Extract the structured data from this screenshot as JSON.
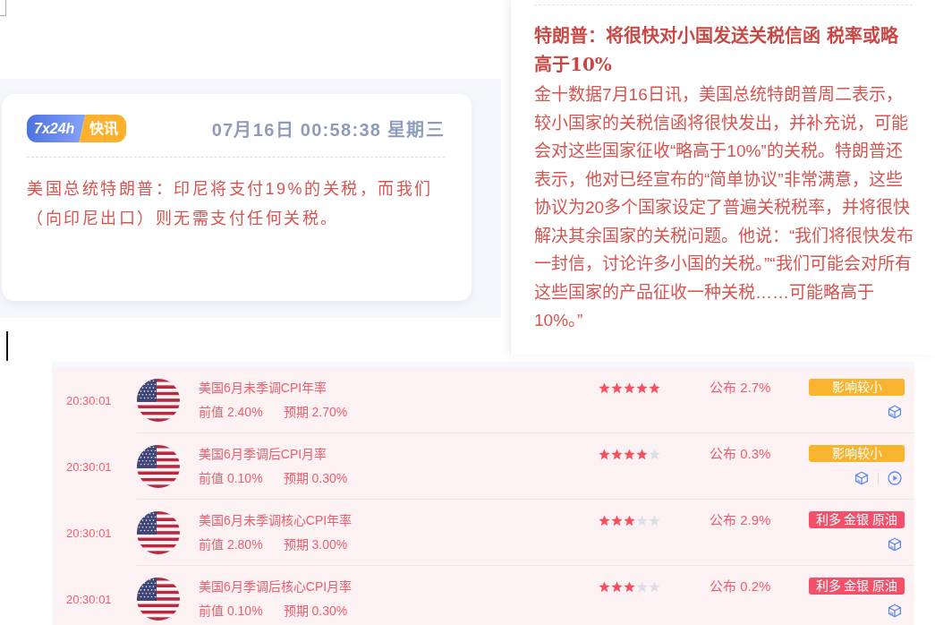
{
  "flash_card": {
    "badge": {
      "left": "7x24h",
      "right": "快讯"
    },
    "datetime": "07月16日 00:58:38 星期三",
    "text": "美国总统特朗普：印尼将支付19%的关税，而我们（向印尼出口）则无需支付任何关税。"
  },
  "article": {
    "title": "特朗普：将很快对小国发送关税信函 税率或略高于10%",
    "body": "金十数据7月16日讯，美国总统特朗普周二表示，较小国家的关税信函将很快发出，并补充说，可能会对这些国家征收“略高于10%”的关税。特朗普还表示，他对已经宣布的“简单协议”非常满意，这些协议为20多个国家设定了普遍关税税率，并将很快解决其余国家的关税问题。他说：“我们将很快发布一封信，讨论许多小国的关税。”“我们可能会对所有这些国家的产品征收一种关税……可能略高于10%。”"
  },
  "calendar": {
    "rows": [
      {
        "time": "20:30:01",
        "title": "美国6月未季调CPI年率",
        "previous": "前值 2.40%",
        "forecast": "预期 2.70%",
        "stars": 5,
        "actual": "公布 2.7%",
        "impact": {
          "label": "影响较小",
          "color": "#f8b42e"
        },
        "video": false
      },
      {
        "time": "20:30:01",
        "title": "美国6月季调后CPI月率",
        "previous": "前值 0.10%",
        "forecast": "预期 0.30%",
        "stars": 4,
        "actual": "公布 0.3%",
        "impact": {
          "label": "影响较小",
          "color": "#f8b42e"
        },
        "video": true
      },
      {
        "time": "20:30:01",
        "title": "美国6月未季调核心CPI年率",
        "previous": "前值 2.80%",
        "forecast": "预期 3.00%",
        "stars": 3,
        "actual": "公布 2.9%",
        "impact": {
          "label": "利多 金银 原油",
          "color": "#f5506a"
        },
        "video": false
      },
      {
        "time": "20:30:01",
        "title": "美国6月季调后核心CPI月率",
        "previous": "前值 0.10%",
        "forecast": "预期 0.30%",
        "stars": 3,
        "actual": "公布 0.2%",
        "impact": {
          "label": "利多 金银 原油",
          "color": "#f5506a"
        },
        "video": false
      }
    ]
  }
}
